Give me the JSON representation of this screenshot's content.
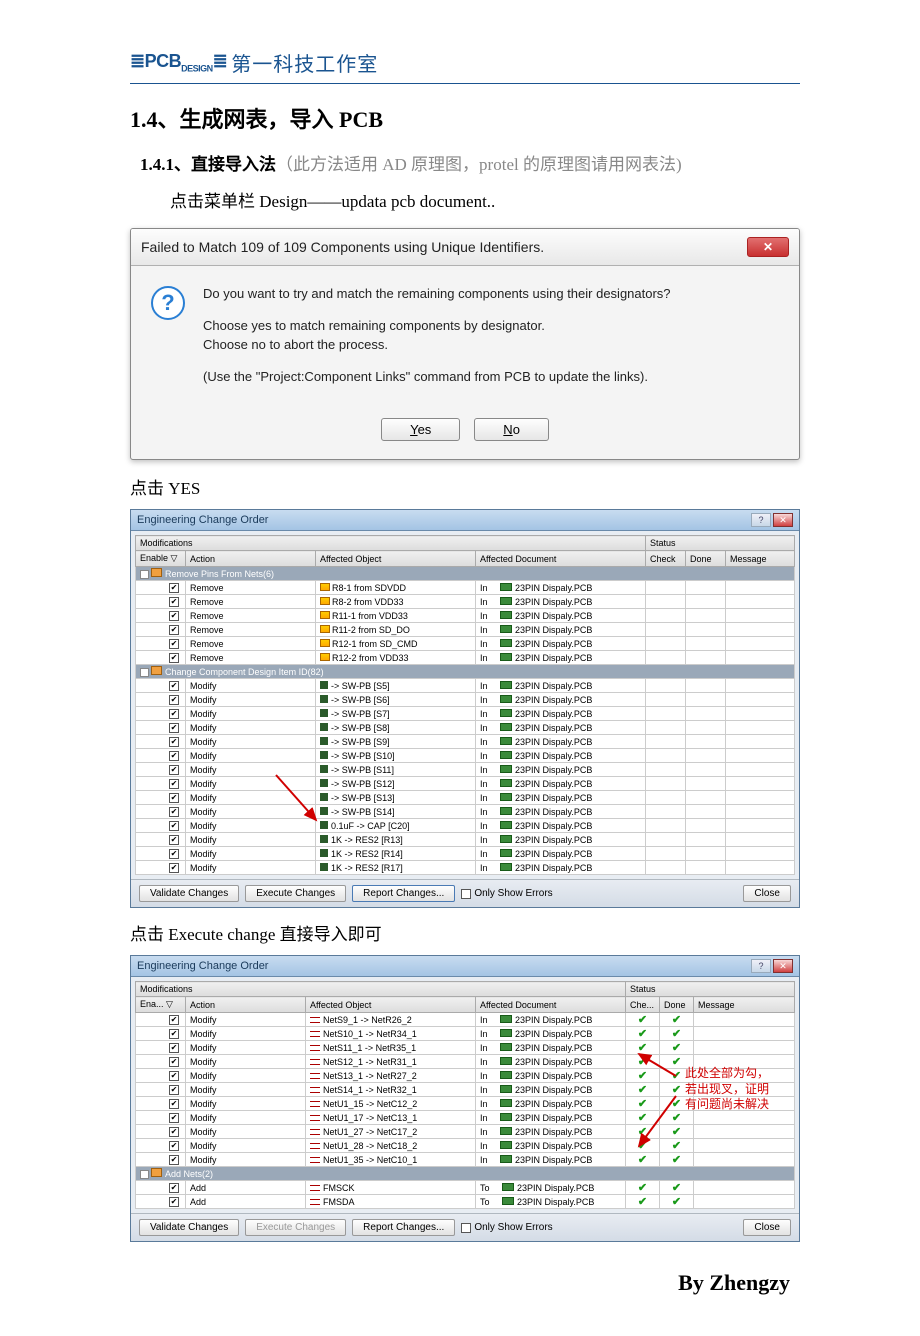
{
  "brand": {
    "logo_prefix": "≣",
    "logo1": "PCB",
    "logo_sub": "DESIGN",
    "cn": "第一科技工作室"
  },
  "h1": "1.4、生成网表，导入 PCB",
  "h2_main": "1.4.1、直接导入法",
  "h2_gray": "（此方法适用 AD 原理图，protel 的原理图请用网表法)",
  "body1": "点击菜单栏 Design——updata pcb document..",
  "dlg1": {
    "title": "Failed to Match 109 of 109 Components using Unique Identifiers.",
    "line1": "Do you want to try and match the remaining components using their designators?",
    "line2a": "Choose yes to match remaining components by designator.",
    "line2b": "Choose no to abort the process.",
    "line3": "(Use the \"Project:Component Links\" command from PCB to update the links).",
    "yes": "Yes",
    "no": "No",
    "no_u": "N"
  },
  "cap1": "点击 YES",
  "eco_title": "Engineering Change Order",
  "cols": {
    "mod": "Modifications",
    "enable": "Enable",
    "action": "Action",
    "affobj": "Affected Object",
    "affdoc": "Affected Document",
    "status": "Status",
    "check": "Check",
    "done": "Done",
    "msg": "Message",
    "ena_short": "Ena...",
    "che_short": "Che..."
  },
  "groups": {
    "g1": "Remove Pins From Nets(6)",
    "g2": "Change Component Design Item ID(82)",
    "g3": "Add Nets(2)"
  },
  "eco1_rows": [
    {
      "a": "Remove",
      "o": "R8-1 from SDVDD",
      "d": "23PIN Dispaly.PCB"
    },
    {
      "a": "Remove",
      "o": "R8-2 from VDD33",
      "d": "23PIN Dispaly.PCB"
    },
    {
      "a": "Remove",
      "o": "R11-1 from VDD33",
      "d": "23PIN Dispaly.PCB"
    },
    {
      "a": "Remove",
      "o": "R11-2 from SD_DO",
      "d": "23PIN Dispaly.PCB"
    },
    {
      "a": "Remove",
      "o": "R12-1 from SD_CMD",
      "d": "23PIN Dispaly.PCB"
    },
    {
      "a": "Remove",
      "o": "R12-2 from VDD33",
      "d": "23PIN Dispaly.PCB"
    }
  ],
  "eco1_rows2": [
    {
      "a": "Modify",
      "o": "-> SW-PB [S5]",
      "d": "23PIN Dispaly.PCB"
    },
    {
      "a": "Modify",
      "o": "-> SW-PB [S6]",
      "d": "23PIN Dispaly.PCB"
    },
    {
      "a": "Modify",
      "o": "-> SW-PB [S7]",
      "d": "23PIN Dispaly.PCB"
    },
    {
      "a": "Modify",
      "o": "-> SW-PB [S8]",
      "d": "23PIN Dispaly.PCB"
    },
    {
      "a": "Modify",
      "o": "-> SW-PB [S9]",
      "d": "23PIN Dispaly.PCB"
    },
    {
      "a": "Modify",
      "o": "-> SW-PB [S10]",
      "d": "23PIN Dispaly.PCB"
    },
    {
      "a": "Modify",
      "o": "-> SW-PB [S11]",
      "d": "23PIN Dispaly.PCB"
    },
    {
      "a": "Modify",
      "o": "-> SW-PB [S12]",
      "d": "23PIN Dispaly.PCB"
    },
    {
      "a": "Modify",
      "o": "-> SW-PB [S13]",
      "d": "23PIN Dispaly.PCB"
    },
    {
      "a": "Modify",
      "o": "-> SW-PB [S14]",
      "d": "23PIN Dispaly.PCB"
    },
    {
      "a": "Modify",
      "o": "0.1uF -> CAP [C20]",
      "d": "23PIN Dispaly.PCB"
    },
    {
      "a": "Modify",
      "o": "1K -> RES2 [R13]",
      "d": "23PIN Dispaly.PCB"
    },
    {
      "a": "Modify",
      "o": "1K -> RES2 [R14]",
      "d": "23PIN Dispaly.PCB"
    },
    {
      "a": "Modify",
      "o": "1K -> RES2 [R17]",
      "d": "23PIN Dispaly.PCB"
    }
  ],
  "eco_btn": {
    "validate": "Validate Changes",
    "execute": "Execute Changes",
    "report": "Report Changes...",
    "onlyerr": "Only Show Errors",
    "close": "Close"
  },
  "cap2": "点击 Execute change 直接导入即可",
  "eco2_rows": [
    {
      "a": "Modify",
      "o": "NetS9_1 -> NetR26_2",
      "d": "23PIN Dispaly.PCB"
    },
    {
      "a": "Modify",
      "o": "NetS10_1 -> NetR34_1",
      "d": "23PIN Dispaly.PCB"
    },
    {
      "a": "Modify",
      "o": "NetS11_1 -> NetR35_1",
      "d": "23PIN Dispaly.PCB"
    },
    {
      "a": "Modify",
      "o": "NetS12_1 -> NetR31_1",
      "d": "23PIN Dispaly.PCB"
    },
    {
      "a": "Modify",
      "o": "NetS13_1 -> NetR27_2",
      "d": "23PIN Dispaly.PCB"
    },
    {
      "a": "Modify",
      "o": "NetS14_1 -> NetR32_1",
      "d": "23PIN Dispaly.PCB"
    },
    {
      "a": "Modify",
      "o": "NetU1_15 -> NetC12_2",
      "d": "23PIN Dispaly.PCB"
    },
    {
      "a": "Modify",
      "o": "NetU1_17 -> NetC13_1",
      "d": "23PIN Dispaly.PCB"
    },
    {
      "a": "Modify",
      "o": "NetU1_27 -> NetC17_2",
      "d": "23PIN Dispaly.PCB"
    },
    {
      "a": "Modify",
      "o": "NetU1_28 -> NetC18_2",
      "d": "23PIN Dispaly.PCB"
    },
    {
      "a": "Modify",
      "o": "NetU1_35 -> NetC10_1",
      "d": "23PIN Dispaly.PCB"
    }
  ],
  "eco2_adds": [
    {
      "a": "Add",
      "o": "FMSCK",
      "t": "To",
      "d": "23PIN Dispaly.PCB"
    },
    {
      "a": "Add",
      "o": "FMSDA",
      "t": "To",
      "d": "23PIN Dispaly.PCB"
    }
  ],
  "in_label": "In",
  "annotation": {
    "l1": "此处全部为勾，",
    "l2": "若出现叉，证明",
    "l3": "有问题尚未解决"
  },
  "footer": "By Zhengzy"
}
